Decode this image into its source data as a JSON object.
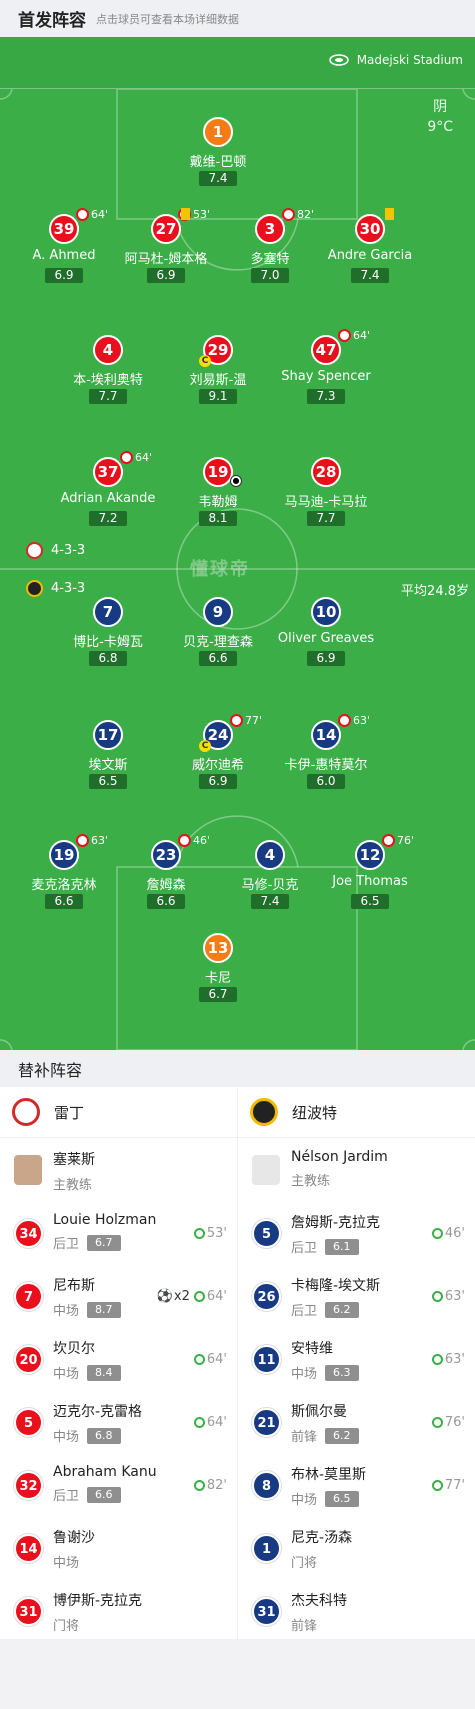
{
  "header": {
    "title": "首发阵容",
    "subtitle": "点击球员可查看本场详细数据"
  },
  "stadium": "Madejski Stadium",
  "weather": {
    "cond": "阴",
    "temp": "9°C"
  },
  "home_formation": "4-3-3",
  "away_formation": "4-3-3",
  "avg_age": "平均24.8岁",
  "watermark": "懂球帝",
  "home_players": [
    {
      "no": "1",
      "name": "戴维-巴顿",
      "rating": "7.4",
      "ev": "",
      "gk": true
    },
    {
      "no": "39",
      "name": "A. Ahmed",
      "rating": "6.9",
      "ev": "64'"
    },
    {
      "no": "27",
      "name": "阿马杜-姆本格",
      "rating": "6.9",
      "ev": "53'"
    },
    {
      "no": "3",
      "name": "多塞特",
      "rating": "7.0",
      "ev": "82'"
    },
    {
      "no": "30",
      "name": "Andre Garcia",
      "rating": "7.4",
      "ev": ""
    },
    {
      "no": "4",
      "name": "本-埃利奥特",
      "rating": "7.7",
      "ev": ""
    },
    {
      "no": "29",
      "name": "刘易斯-温",
      "rating": "9.1",
      "ev": ""
    },
    {
      "no": "47",
      "name": "Shay Spencer",
      "rating": "7.3",
      "ev": "64'"
    },
    {
      "no": "37",
      "name": "Adrian Akande",
      "rating": "7.2",
      "ev": "64'"
    },
    {
      "no": "19",
      "name": "韦勒姆",
      "rating": "8.1",
      "ev": ""
    },
    {
      "no": "28",
      "name": "马马迪-卡马拉",
      "rating": "7.7",
      "ev": ""
    }
  ],
  "away_players": [
    {
      "no": "7",
      "name": "博比-卡姆瓦",
      "rating": "6.8",
      "ev": ""
    },
    {
      "no": "9",
      "name": "贝克-理查森",
      "rating": "6.6",
      "ev": ""
    },
    {
      "no": "10",
      "name": "Oliver Greaves",
      "rating": "6.9",
      "ev": ""
    },
    {
      "no": "17",
      "name": "埃文斯",
      "rating": "6.5",
      "ev": ""
    },
    {
      "no": "24",
      "name": "威尔迪希",
      "rating": "6.9",
      "ev": "77'"
    },
    {
      "no": "14",
      "name": "卡伊-惠特莫尔",
      "rating": "6.0",
      "ev": "63'"
    },
    {
      "no": "19",
      "name": "麦克洛克林",
      "rating": "6.6",
      "ev": "63'"
    },
    {
      "no": "23",
      "name": "詹姆森",
      "rating": "6.6",
      "ev": "46'"
    },
    {
      "no": "4",
      "name": "马修-贝克",
      "rating": "7.4",
      "ev": ""
    },
    {
      "no": "12",
      "name": "Joe Thomas",
      "rating": "6.5",
      "ev": "76'"
    },
    {
      "no": "13",
      "name": "卡尼",
      "rating": "6.7",
      "ev": "",
      "gk": true
    }
  ],
  "subs": {
    "title": "替补阵容",
    "home_team": "雷丁",
    "away_team": "纽波特",
    "home_coach": "塞莱斯",
    "away_coach": "Nélson Jardim",
    "coach_label": "主教练",
    "home": [
      {
        "no": "34",
        "name": "Louie Holzman",
        "pos": "后卫",
        "rating": "6.7",
        "time": "53'"
      },
      {
        "no": "7",
        "name": "尼布斯",
        "pos": "中场",
        "rating": "8.7",
        "time": "64'",
        "goals": "x2"
      },
      {
        "no": "20",
        "name": "坎贝尔",
        "pos": "中场",
        "rating": "8.4",
        "time": "64'"
      },
      {
        "no": "5",
        "name": "迈克尔-克雷格",
        "pos": "中场",
        "rating": "6.8",
        "time": "64'"
      },
      {
        "no": "32",
        "name": "Abraham Kanu",
        "pos": "后卫",
        "rating": "6.6",
        "time": "82'"
      },
      {
        "no": "14",
        "name": "鲁谢沙",
        "pos": "中场",
        "rating": "",
        "time": ""
      },
      {
        "no": "31",
        "name": "博伊斯-克拉克",
        "pos": "门将",
        "rating": "",
        "time": ""
      }
    ],
    "away": [
      {
        "no": "5",
        "name": "詹姆斯-克拉克",
        "pos": "后卫",
        "rating": "6.1",
        "time": "46'"
      },
      {
        "no": "26",
        "name": "卡梅隆-埃文斯",
        "pos": "后卫",
        "rating": "6.2",
        "time": "63'"
      },
      {
        "no": "11",
        "name": "安特维",
        "pos": "中场",
        "rating": "6.3",
        "time": "63'"
      },
      {
        "no": "21",
        "name": "斯佩尔曼",
        "pos": "前锋",
        "rating": "6.2",
        "time": "76'"
      },
      {
        "no": "8",
        "name": "布林-莫里斯",
        "pos": "中场",
        "rating": "6.5",
        "time": "77'"
      },
      {
        "no": "1",
        "name": "尼克-汤森",
        "pos": "门将",
        "rating": "",
        "time": ""
      },
      {
        "no": "31",
        "name": "杰夫科特",
        "pos": "前锋",
        "rating": "",
        "time": ""
      }
    ]
  }
}
